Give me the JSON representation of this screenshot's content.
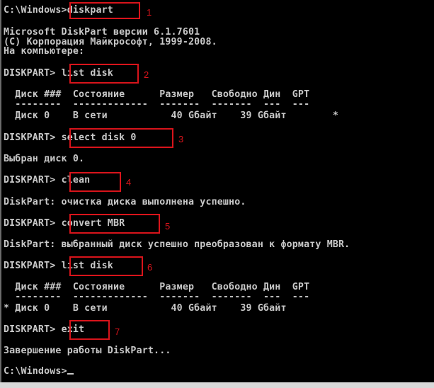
{
  "console": {
    "lines": {
      "l1_prompt": "C:\\Windows>",
      "l1_cmd": "diskpart",
      "h1": "Microsoft DiskPart версии 6.1.7601",
      "h2": "(C) Корпорация Майкрософт, 1999-2008.",
      "h3": "На компьютере:",
      "p2": "DISKPART> ",
      "c2": "list disk",
      "t1_head": "  Диск ###  Состояние      Размер   Свободно Дин  GPT",
      "t1_dash": "  --------  -------------  -------  -------  ---  ---",
      "t1_row": "  Диск 0    В сети           40 Gбайт    39 Gбайт        *",
      "p3": "DISKPART> ",
      "c3": "select disk 0",
      "o3": "Выбран диск 0.",
      "p4": "DISKPART> ",
      "c4": "clean",
      "o4": "DiskPart: очистка диска выполнена успешно.",
      "p5": "DISKPART> ",
      "c5": "convert MBR",
      "o5": "DiskPart: выбранный диск успешно преобразован к формату MBR.",
      "p6": "DISKPART> ",
      "c6": "list disk",
      "t2_head": "  Диск ###  Состояние      Размер   Свободно Дин  GPT",
      "t2_dash": "  --------  -------------  -------  -------  ---  ---",
      "t2_row": "* Диск 0    В сети           40 Gбайт    39 Gбайт",
      "p7": "DISKPART> ",
      "c7": "exit",
      "o7": "Завершение работы DiskPart...",
      "final_prompt": "C:\\Windows>"
    },
    "step_numbers": [
      "1",
      "2",
      "3",
      "4",
      "5",
      "6",
      "7"
    ],
    "highlight_color": "#d8141b"
  }
}
